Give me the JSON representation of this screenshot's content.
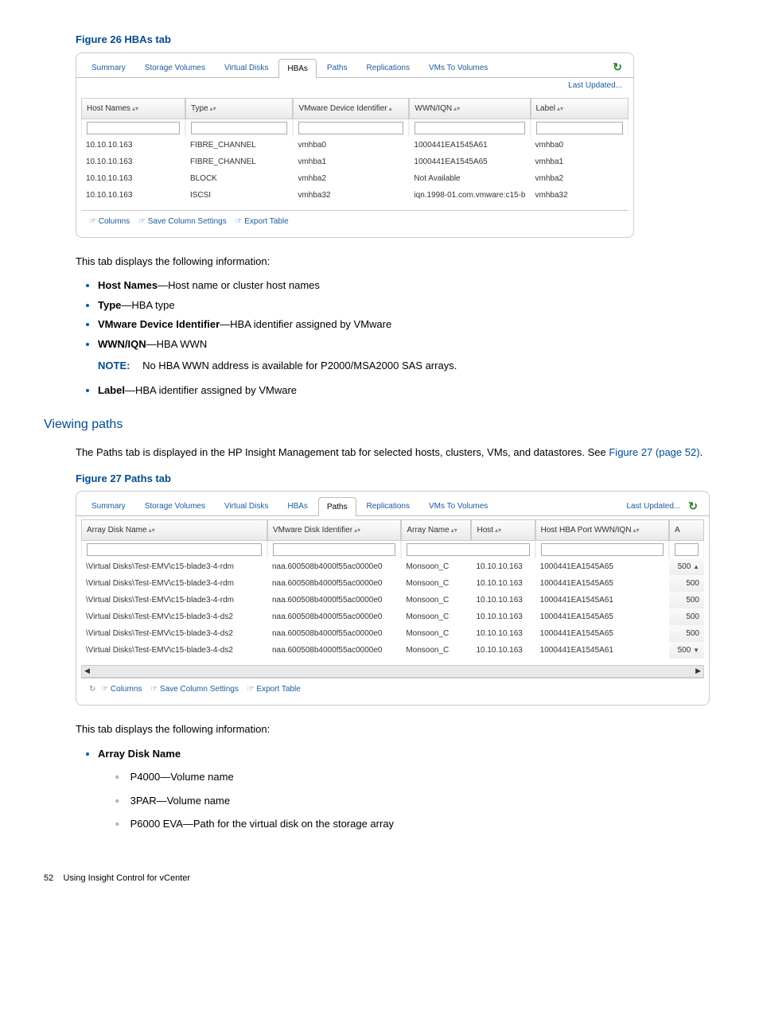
{
  "figure26": {
    "caption": "Figure 26 HBAs tab",
    "tabs": [
      "Summary",
      "Storage Volumes",
      "Virtual Disks",
      "HBAs",
      "Paths",
      "Replications",
      "VMs To Volumes"
    ],
    "active_tab_idx": 3,
    "last_updated": "Last Updated...",
    "columns": [
      "Host Names",
      "Type",
      "VMware Device Identifier",
      "WWN/IQN",
      "Label"
    ],
    "rows": [
      {
        "host": "10.10.10.163",
        "type": "FIBRE_CHANNEL",
        "vdi": "vmhba0",
        "wwn": "1000441EA1545A61",
        "label": "vmhba0"
      },
      {
        "host": "10.10.10.163",
        "type": "FIBRE_CHANNEL",
        "vdi": "vmhba1",
        "wwn": "1000441EA1545A65",
        "label": "vmhba1"
      },
      {
        "host": "10.10.10.163",
        "type": "BLOCK",
        "vdi": "vmhba2",
        "wwn": "Not Available",
        "label": "vmhba2"
      },
      {
        "host": "10.10.10.163",
        "type": "ISCSI",
        "vdi": "vmhba32",
        "wwn": "iqn.1998-01.com.vmware:c15-b",
        "label": "vmhba32"
      }
    ],
    "footer_links": [
      "Columns",
      "Save Column Settings",
      "Export Table"
    ]
  },
  "info_intro": "This tab displays the following information:",
  "info_items": [
    {
      "term": "Host Names",
      "desc": "—Host name or cluster host names"
    },
    {
      "term": "Type",
      "desc": "—HBA type"
    },
    {
      "term": "VMware Device Identifier",
      "desc": "—HBA identifier assigned by VMware"
    },
    {
      "term": "WWN/IQN",
      "desc": "—HBA WWN"
    },
    {
      "term": "Label",
      "desc": "—HBA identifier assigned by VMware"
    }
  ],
  "note": {
    "label": "NOTE:",
    "text": "No HBA WWN address is available for P2000/MSA2000 SAS arrays."
  },
  "viewing_paths": {
    "heading": "Viewing paths",
    "para_pre": "The Paths tab is displayed in the HP Insight Management tab for selected hosts, clusters, VMs, and datastores. See ",
    "para_link": "Figure 27 (page 52)",
    "para_post": "."
  },
  "figure27": {
    "caption": "Figure 27 Paths tab",
    "tabs": [
      "Summary",
      "Storage Volumes",
      "Virtual Disks",
      "HBAs",
      "Paths",
      "Replications",
      "VMs To Volumes"
    ],
    "active_tab_idx": 4,
    "last_updated": "Last Updated...",
    "columns": [
      "Array Disk Name",
      "VMware Disk Identifier",
      "Array Name",
      "Host",
      "Host HBA Port WWN/IQN",
      "A"
    ],
    "rows": [
      {
        "adn": "\\Virtual Disks\\Test-EMV\\c15-blade3-4-rdm",
        "vdi": "naa.600508b4000f55ac0000e0",
        "an": "Monsoon_C",
        "host": "10.10.10.163",
        "wwn": "1000441EA1545A65",
        "sc": "500"
      },
      {
        "adn": "\\Virtual Disks\\Test-EMV\\c15-blade3-4-rdm",
        "vdi": "naa.600508b4000f55ac0000e0",
        "an": "Monsoon_C",
        "host": "10.10.10.163",
        "wwn": "1000441EA1545A65",
        "sc": "500"
      },
      {
        "adn": "\\Virtual Disks\\Test-EMV\\c15-blade3-4-rdm",
        "vdi": "naa.600508b4000f55ac0000e0",
        "an": "Monsoon_C",
        "host": "10.10.10.163",
        "wwn": "1000441EA1545A61",
        "sc": "500"
      },
      {
        "adn": "\\Virtual Disks\\Test-EMV\\c15-blade3-4-ds2",
        "vdi": "naa.600508b4000f55ac0000e0",
        "an": "Monsoon_C",
        "host": "10.10.10.163",
        "wwn": "1000441EA1545A65",
        "sc": "500"
      },
      {
        "adn": "\\Virtual Disks\\Test-EMV\\c15-blade3-4-ds2",
        "vdi": "naa.600508b4000f55ac0000e0",
        "an": "Monsoon_C",
        "host": "10.10.10.163",
        "wwn": "1000441EA1545A65",
        "sc": "500"
      },
      {
        "adn": "\\Virtual Disks\\Test-EMV\\c15-blade3-4-ds2",
        "vdi": "naa.600508b4000f55ac0000e0",
        "an": "Monsoon_C",
        "host": "10.10.10.163",
        "wwn": "1000441EA1545A61",
        "sc": "500"
      }
    ],
    "footer_links": [
      "Columns",
      "Save Column Settings",
      "Export Table"
    ]
  },
  "info2_items": {
    "heading": "Array Disk Name",
    "subs": [
      "P4000—Volume name",
      "3PAR—Volume name",
      "P6000 EVA—Path for the virtual disk on the storage array"
    ]
  },
  "page_footer": {
    "num": "52",
    "text": "Using Insight Control for vCenter"
  }
}
